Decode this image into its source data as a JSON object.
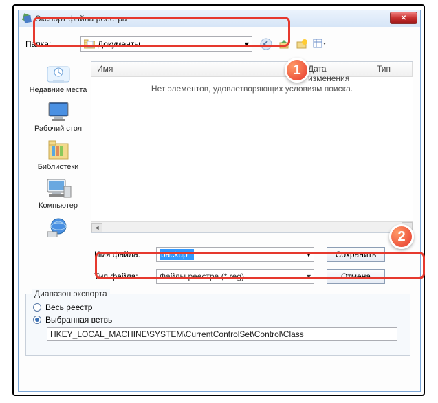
{
  "window": {
    "title": "Экспорт файла реестра"
  },
  "folder": {
    "label": "Папка:",
    "value": "Документы"
  },
  "places": [
    {
      "id": "recent",
      "label": "Недавние места"
    },
    {
      "id": "desktop",
      "label": "Рабочий стол"
    },
    {
      "id": "libraries",
      "label": "Библиотеки"
    },
    {
      "id": "computer",
      "label": "Компьютер"
    },
    {
      "id": "network",
      "label": ""
    }
  ],
  "list": {
    "columns": {
      "name": "Имя",
      "date": "Дата изменения",
      "type": "Тип"
    },
    "empty_message": "Нет элементов, удовлетворяющих условиям поиска."
  },
  "filename": {
    "label": "Имя файла:",
    "value": "backup"
  },
  "filetype": {
    "label": "Тип файла:",
    "value": "Файлы реестра (*.reg)"
  },
  "buttons": {
    "save": "Сохранить",
    "cancel": "Отмена"
  },
  "export_range": {
    "legend": "Диапазон экспорта",
    "all": "Весь реестр",
    "branch": "Выбранная ветвь",
    "branch_value": "HKEY_LOCAL_MACHINE\\SYSTEM\\CurrentControlSet\\Control\\Class"
  },
  "annotations": {
    "badge1": "1",
    "badge2": "2"
  }
}
